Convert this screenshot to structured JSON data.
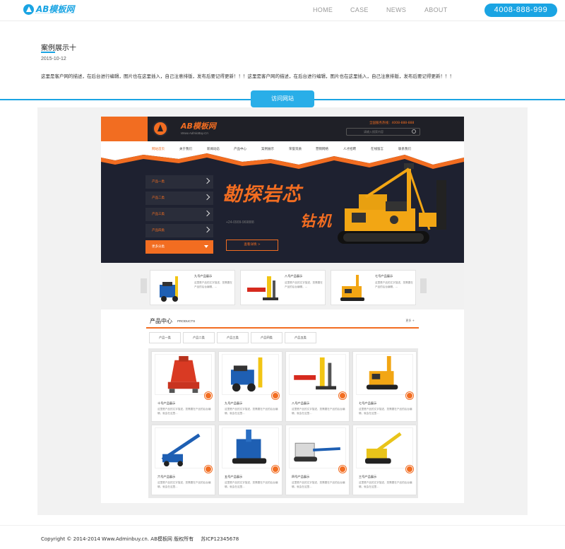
{
  "logo": {
    "text": "AB模板网",
    "icon": "ab-logo-icon"
  },
  "nav": {
    "items": [
      {
        "label": "HOME"
      },
      {
        "label": "CASE"
      },
      {
        "label": "NEWS"
      },
      {
        "label": "ABOUT"
      }
    ],
    "phone": "4008-888-999"
  },
  "case": {
    "title": "案例展示十",
    "date": "2015-10-12",
    "description": "这里是客户网的描述，在后台进行编辑，图片也在这里插入，自己注意排版，发布后要记得更新！！！这里是客户网的描述，在后台进行编辑，图片也在这里插入，自己注意排版，发布后要记得更新！！！",
    "visit_button": "访问网站"
  },
  "preview": {
    "logo_text": "AB模板网",
    "logo_sub": "Www.AdminBuy.Cn",
    "hotline": "全国服务热线：4008-888-888",
    "search_placeholder": "请输入搜索内容",
    "menu": [
      "网站首页",
      "关于我们",
      "新闻动态",
      "产品中心",
      "案例展示",
      "荣誉资质",
      "营销网络",
      "人才招聘",
      "在线留言",
      "联系我们"
    ],
    "side_menu": [
      "产品一类",
      "产品二类",
      "产品三类",
      "产品四类",
      "更多分类"
    ],
    "banner_line1": "勘探岩芯",
    "banner_line2": "钻机",
    "banner_tel": "+24-0909-969888",
    "consult_button": "查看详情 >",
    "carousel": [
      {
        "title": "九号产品展示",
        "desc": "这里是产品的文字描述，您需要在产品的后台编辑，..."
      },
      {
        "title": "八号产品展示",
        "desc": "这里是产品的文字描述，您需要在产品的后台编辑，..."
      },
      {
        "title": "七号产品展示",
        "desc": "这里是产品的文字描述，您需要在产品的后台编辑，..."
      }
    ],
    "products_title": "产品中心",
    "products_sub": "PRODUCTS",
    "products_more": "更多 +",
    "tabs": [
      "产品一类",
      "产品二类",
      "产品三类",
      "产品四类",
      "产品五类"
    ],
    "items": [
      {
        "name": "十号产品展示",
        "desc": "这里是产品的文字描述，您需要在产品的后台编辑，就会在这里..."
      },
      {
        "name": "九号产品展示",
        "desc": "这里是产品的文字描述，您需要在产品的后台编辑，就会在这里..."
      },
      {
        "name": "八号产品展示",
        "desc": "这里是产品的文字描述，您需要在产品的后台编辑，就会在这里..."
      },
      {
        "name": "七号产品展示",
        "desc": "这里是产品的文字描述，您需要在产品的后台编辑，就会在这里..."
      },
      {
        "name": "六号产品展示",
        "desc": "这里是产品的文字描述，您需要在产品的后台编辑，就会在这里..."
      },
      {
        "name": "五号产品展示",
        "desc": "这里是产品的文字描述，您需要在产品的后台编辑，就会在这里..."
      },
      {
        "name": "四号产品展示",
        "desc": "这里是产品的文字描述，您需要在产品的后台编辑，就会在这里..."
      },
      {
        "name": "三号产品展示",
        "desc": "这里是产品的文字描述，您需要在产品的后台编辑，就会在这里..."
      }
    ]
  },
  "footer": {
    "copyright": "Copyright © 2014-2014 Www.Adminbuy.cn. AB模板网 版权所有",
    "icp": "苏ICP12345678"
  },
  "colors": {
    "accent": "#1aa4e3",
    "preview_orange": "#f26d21",
    "preview_dark": "#1f2027"
  }
}
